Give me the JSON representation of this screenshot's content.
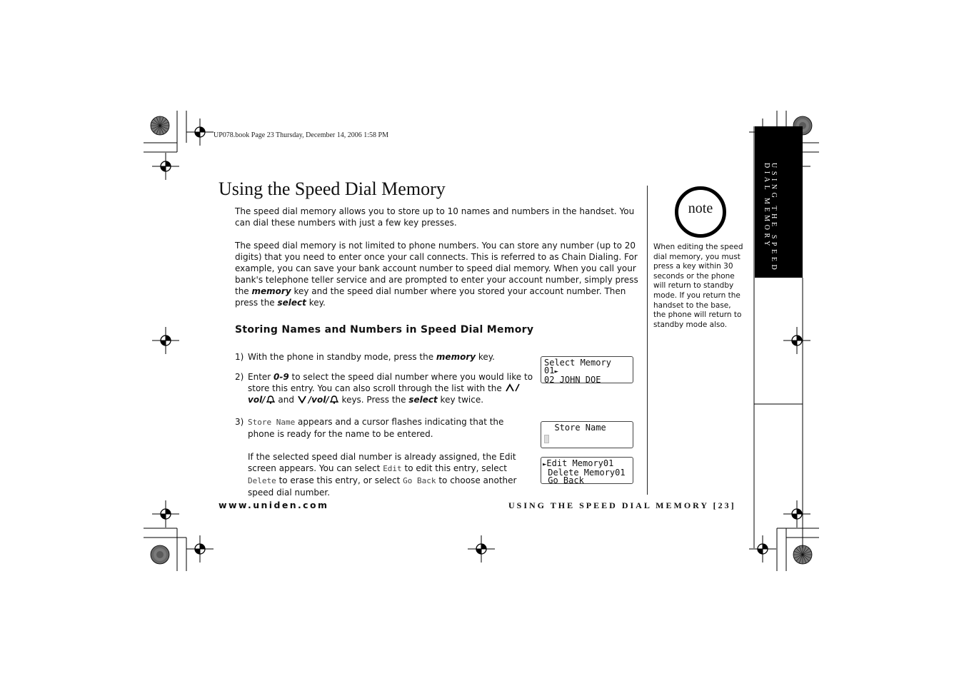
{
  "header": {
    "print_info": "UP078.book  Page 23  Thursday, December 14, 2006  1:58 PM"
  },
  "title": "Using the Speed Dial Memory",
  "paragraphs": {
    "p1": "The speed dial memory allows you to store up to 10 names and numbers in the handset. You can dial these numbers with just a few key presses.",
    "p2_a": "The speed dial memory is not limited to phone numbers. You can store any number (up to 20 digits) that you need to enter once your call connects. This is referred to as Chain Dialing. For example, you can save your bank account number to speed dial memory. When you call your bank's telephone teller service and are prompted to enter your account number, simply press the ",
    "p2_memory": "memory",
    "p2_b": " key and the speed dial number where you stored your account number. Then press the ",
    "p2_select": "select",
    "p2_c": " key."
  },
  "subhead": "Storing Names and Numbers in Speed Dial Memory",
  "steps": {
    "s1_num": "1)",
    "s1_a": "With the phone in standby mode, press the ",
    "s1_key": "memory",
    "s1_b": " key.",
    "s2_num": "2)",
    "s2_a": "Enter ",
    "s2_key": "0-9",
    "s2_b": " to select the speed dial number where you would like to store this entry. You can also scroll through the list with the ",
    "s2_vol1": "vol/",
    "s2_and": " and ",
    "s2_vol2": "/vol/",
    "s2_c": " keys. Press the ",
    "s2_select": "select",
    "s2_d": " key twice.",
    "s3_num": "3)",
    "s3_lcd": "Store Name",
    "s3_a": " appears and a cursor flashes indicating that the phone is ready for the name to be entered.",
    "s3b_a": "If the selected speed dial number is already assigned, the Edit screen appears. You can select ",
    "s3b_edit": "Edit",
    "s3b_b": " to edit this entry, select ",
    "s3b_delete": "Delete",
    "s3b_c": " to erase this entry, or select ",
    "s3b_goback": "Go Back",
    "s3b_d": " to choose another speed dial number."
  },
  "lcd": {
    "select_memory": {
      "line1": "Select Memory",
      "line2": "01",
      "line3": "02 JOHN DOE"
    },
    "store_name": {
      "line1": "  Store Name"
    },
    "edit_memory": {
      "line1": "Edit Memory01",
      "line2": " Delete Memory01",
      "line3": " Go Back"
    }
  },
  "note": {
    "word": "note",
    "text": "When editing the speed dial memory, you must press a key within 30 seconds or the phone will return to standby mode. If you return the handset to the base, the phone will return to standby mode also."
  },
  "side_tab": {
    "line1": "USING THE SPEED",
    "line2": "DIAL MEMORY"
  },
  "footer": {
    "url": "www.uniden.com",
    "page_title": "USING THE SPEED DIAL MEMORY [23]"
  }
}
